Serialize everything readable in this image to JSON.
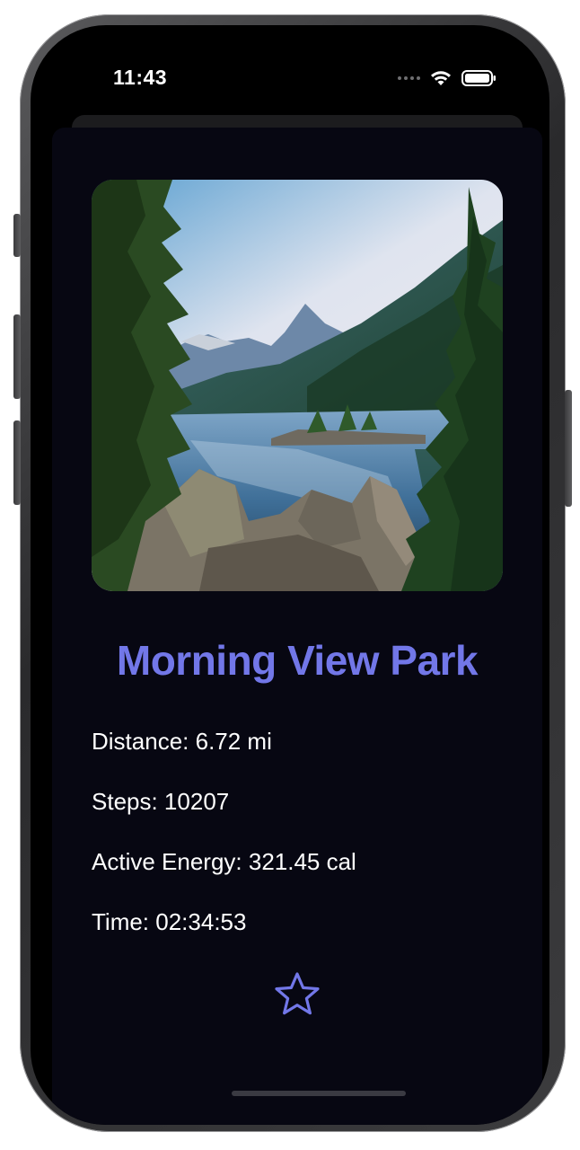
{
  "status_bar": {
    "time": "11:43",
    "icons": [
      "signal-dots-icon",
      "wifi-icon",
      "battery-icon"
    ]
  },
  "park": {
    "image_alt": "Mountain lake framed by pine trees",
    "name": "Morning View Park",
    "stats": [
      {
        "text": "Distance: 6.72 mi"
      },
      {
        "text": "Steps: 10207"
      },
      {
        "text": "Active Energy: 321.45 cal"
      },
      {
        "text": "Time: 02:34:53"
      }
    ],
    "favorite_icon": "star-outline-icon"
  },
  "colors": {
    "accent": "#7277e8",
    "sheet_background": "#070712",
    "text": "#ffffff"
  }
}
